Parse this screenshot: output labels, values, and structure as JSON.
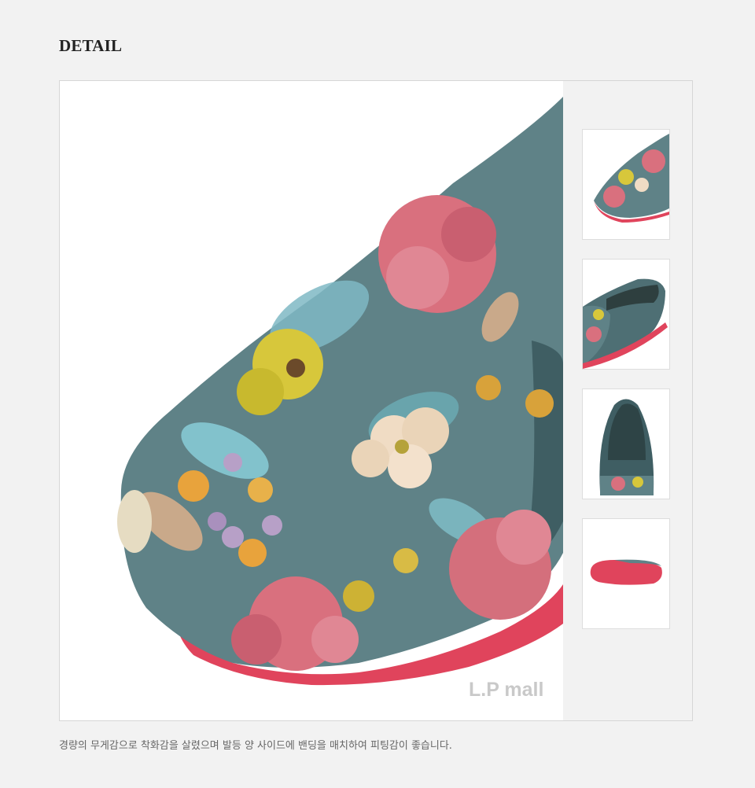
{
  "section": {
    "title": "DETAIL"
  },
  "gallery": {
    "watermark": "L.P mall",
    "thumbnails": [
      {
        "label": "thumbnail-top-view"
      },
      {
        "label": "thumbnail-side-view"
      },
      {
        "label": "thumbnail-front-view"
      },
      {
        "label": "thumbnail-sole-view"
      }
    ]
  },
  "description": "경량의 무게감으로 착화감을 살렸으며 발등 양 사이드에 밴딩을 매치하여 피팅감이 좋습니다.",
  "colors": {
    "upper": "#5c7f85",
    "sole": "#e2465c",
    "pink_flower": "#d9707e",
    "yellow_flower": "#d7c73b",
    "cream_flower": "#f0dcc4"
  }
}
